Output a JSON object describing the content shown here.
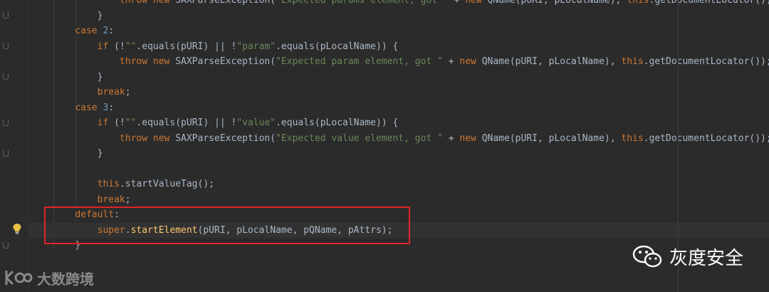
{
  "editor": {
    "lines": [
      [
        {
          "t": "            ",
          "c": "plain"
        },
        {
          "t": "throw new ",
          "c": "kw"
        },
        {
          "t": "SAXParseException(",
          "c": "plain"
        },
        {
          "t": "\"Expected params element, got \"",
          "c": "str"
        },
        {
          "t": " + ",
          "c": "plain"
        },
        {
          "t": "new ",
          "c": "kw"
        },
        {
          "t": "QName(pURI, pLocalName), ",
          "c": "plain"
        },
        {
          "t": "this",
          "c": "kw"
        },
        {
          "t": ".getDocumentLocator());",
          "c": "plain"
        }
      ],
      [
        {
          "t": "        }",
          "c": "plain"
        }
      ],
      [
        {
          "t": "    ",
          "c": "plain"
        },
        {
          "t": "case ",
          "c": "kw"
        },
        {
          "t": "2",
          "c": "num"
        },
        {
          "t": ":",
          "c": "plain"
        }
      ],
      [
        {
          "t": "        ",
          "c": "plain"
        },
        {
          "t": "if ",
          "c": "kw"
        },
        {
          "t": "(!",
          "c": "plain"
        },
        {
          "t": "\"\"",
          "c": "str"
        },
        {
          "t": ".equals(pURI) || !",
          "c": "plain"
        },
        {
          "t": "\"param\"",
          "c": "str"
        },
        {
          "t": ".equals(pLocalName)) {",
          "c": "plain"
        }
      ],
      [
        {
          "t": "            ",
          "c": "plain"
        },
        {
          "t": "throw new ",
          "c": "kw"
        },
        {
          "t": "SAXParseException(",
          "c": "plain"
        },
        {
          "t": "\"Expected param element, got \"",
          "c": "str"
        },
        {
          "t": " + ",
          "c": "plain"
        },
        {
          "t": "new ",
          "c": "kw"
        },
        {
          "t": "QName(pURI, pLocalName), ",
          "c": "plain"
        },
        {
          "t": "this",
          "c": "kw"
        },
        {
          "t": ".getDocumentLocator());",
          "c": "plain"
        }
      ],
      [
        {
          "t": "        }",
          "c": "plain"
        }
      ],
      [
        {
          "t": "        ",
          "c": "plain"
        },
        {
          "t": "break",
          "c": "kw"
        },
        {
          "t": ";",
          "c": "plain"
        }
      ],
      [
        {
          "t": "    ",
          "c": "plain"
        },
        {
          "t": "case ",
          "c": "kw"
        },
        {
          "t": "3",
          "c": "num"
        },
        {
          "t": ":",
          "c": "plain"
        }
      ],
      [
        {
          "t": "        ",
          "c": "plain"
        },
        {
          "t": "if ",
          "c": "kw"
        },
        {
          "t": "(!",
          "c": "plain"
        },
        {
          "t": "\"\"",
          "c": "str"
        },
        {
          "t": ".equals(pURI) || !",
          "c": "plain"
        },
        {
          "t": "\"value\"",
          "c": "str"
        },
        {
          "t": ".equals(pLocalName)) {",
          "c": "plain"
        }
      ],
      [
        {
          "t": "            ",
          "c": "plain"
        },
        {
          "t": "throw new ",
          "c": "kw"
        },
        {
          "t": "SAXParseException(",
          "c": "plain"
        },
        {
          "t": "\"Expected value element, got \"",
          "c": "str"
        },
        {
          "t": " + ",
          "c": "plain"
        },
        {
          "t": "new ",
          "c": "kw"
        },
        {
          "t": "QName(pURI, pLocalName), ",
          "c": "plain"
        },
        {
          "t": "this",
          "c": "kw"
        },
        {
          "t": ".getDocumentLocator());",
          "c": "plain"
        }
      ],
      [
        {
          "t": "        }",
          "c": "plain"
        }
      ],
      [
        {
          "t": "",
          "c": "plain"
        }
      ],
      [
        {
          "t": "        ",
          "c": "plain"
        },
        {
          "t": "this",
          "c": "kw"
        },
        {
          "t": ".startValueTag();",
          "c": "plain"
        }
      ],
      [
        {
          "t": "        ",
          "c": "plain"
        },
        {
          "t": "break",
          "c": "kw"
        },
        {
          "t": ";",
          "c": "plain"
        }
      ],
      [
        {
          "t": "    ",
          "c": "plain"
        },
        {
          "t": "default",
          "c": "kw"
        },
        {
          "t": ":",
          "c": "plain"
        }
      ],
      [
        {
          "t": "        ",
          "c": "plain"
        },
        {
          "t": "super",
          "c": "kw"
        },
        {
          "t": ".",
          "c": "plain"
        },
        {
          "t": "startElement",
          "c": "fn"
        },
        {
          "t": "(pURI, pLocalName, pQName, pAttrs);",
          "c": "plain"
        }
      ],
      [
        {
          "t": "    }",
          "c": "plain"
        }
      ]
    ],
    "current_line_index": 15,
    "highlight_color": "#e0242a"
  },
  "watermark_left": {
    "text": "大数跨境"
  },
  "watermark_right": {
    "text": "灰度安全"
  },
  "colors": {
    "background": "#2b2b2b",
    "keyword": "#cc7832",
    "string": "#6a8759",
    "number": "#6897bb",
    "method": "#ffc66d",
    "text": "#a9b7c6"
  }
}
